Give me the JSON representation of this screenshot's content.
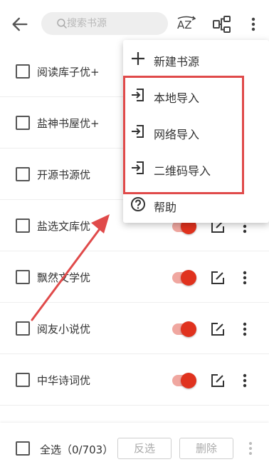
{
  "search": {
    "placeholder": "搜索书源"
  },
  "toolbar": {
    "az_label": "AZ"
  },
  "sources": [
    {
      "name": "阅读库子优+",
      "enabled": true
    },
    {
      "name": "盐神书屋优+",
      "enabled": true
    },
    {
      "name": "开源书源优",
      "enabled": true
    },
    {
      "name": "盐选文库优",
      "enabled": true
    },
    {
      "name": "飘然文学优",
      "enabled": true
    },
    {
      "name": "阅友小说优",
      "enabled": true
    },
    {
      "name": "中华诗词优",
      "enabled": true
    },
    {
      "name": "",
      "enabled": true
    }
  ],
  "menu": {
    "items": [
      {
        "label": "新建书源",
        "icon": "plus-icon"
      },
      {
        "label": "本地导入",
        "icon": "import-icon"
      },
      {
        "label": "网络导入",
        "icon": "import-icon"
      },
      {
        "label": "二维码导入",
        "icon": "import-icon"
      },
      {
        "label": "帮助",
        "icon": "help-icon"
      }
    ]
  },
  "bottom": {
    "select_all_label": "全选（0/703）",
    "invert_label": "反选",
    "delete_label": "删除"
  },
  "colors": {
    "accent": "#e0321e",
    "accent_light": "#f0a7a0",
    "annotation": "#e04a4a"
  }
}
